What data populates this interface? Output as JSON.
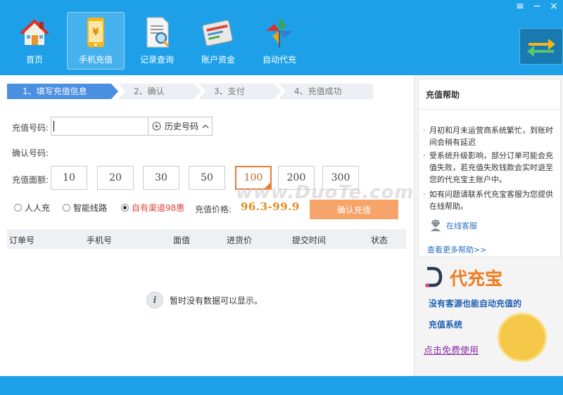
{
  "window": {
    "controls": [
      "≡",
      "−",
      "×"
    ]
  },
  "nav": {
    "items": [
      {
        "label": "首页",
        "icon": "home-icon"
      },
      {
        "label": "手机充值",
        "icon": "phone-recharge-icon",
        "active": true
      },
      {
        "label": "记录查询",
        "icon": "record-search-icon"
      },
      {
        "label": "账户资金",
        "icon": "account-funds-icon"
      },
      {
        "label": "自动代充",
        "icon": "pinwheel-icon"
      }
    ]
  },
  "steps": [
    {
      "label": "1、填写充值信息"
    },
    {
      "label": "2、确认"
    },
    {
      "label": "3、支付"
    },
    {
      "label": "4、充值成功"
    }
  ],
  "form": {
    "phone_label": "充值号码:",
    "phone_value": "",
    "history_label": "历史号码",
    "confirm_label": "确认号码:",
    "amount_label": "充值面额:",
    "amounts": [
      "10",
      "20",
      "30",
      "50",
      "100",
      "200",
      "300"
    ],
    "selected_amount": "100",
    "channels": [
      {
        "label": "人人充",
        "checked": false
      },
      {
        "label": "智能线路",
        "checked": false
      },
      {
        "label": "自有渠道98惠",
        "checked": true
      }
    ],
    "price_label": "充值价格:",
    "price_value": "96.3-99.9",
    "submit_label": "确认充值"
  },
  "table": {
    "columns": [
      "订单号",
      "手机号",
      "面值",
      "进货价",
      "提交时间",
      "状态"
    ],
    "empty_text": "暂时没有数据可以显示。"
  },
  "watermark": "www.DuoTe.com",
  "help": {
    "title": "充值帮助",
    "items": [
      "月初和月末运营商系统繁忙，到账时间会稍有延迟",
      "受系统升级影响，部分订单可能会充值失败，若充值失败钱款会实时退至您的代充宝主账户中。",
      "如有问题请联系代充宝客服为您提供在线帮助。"
    ],
    "online_service": "在线客服",
    "more_help": "查看更多帮助>>"
  },
  "promo": {
    "name": "代充宝",
    "line1": "没有客源也能自动充值的",
    "line2": "充值系统",
    "link": "点击免费使用"
  },
  "colors": {
    "brand_blue": "#1ea0e8",
    "step_active": "#4b8fe0",
    "accent_orange": "#f07a30",
    "price_orange": "#e68a1e",
    "promo_orange": "#f07b1e",
    "link_blue": "#2a6fbf"
  }
}
